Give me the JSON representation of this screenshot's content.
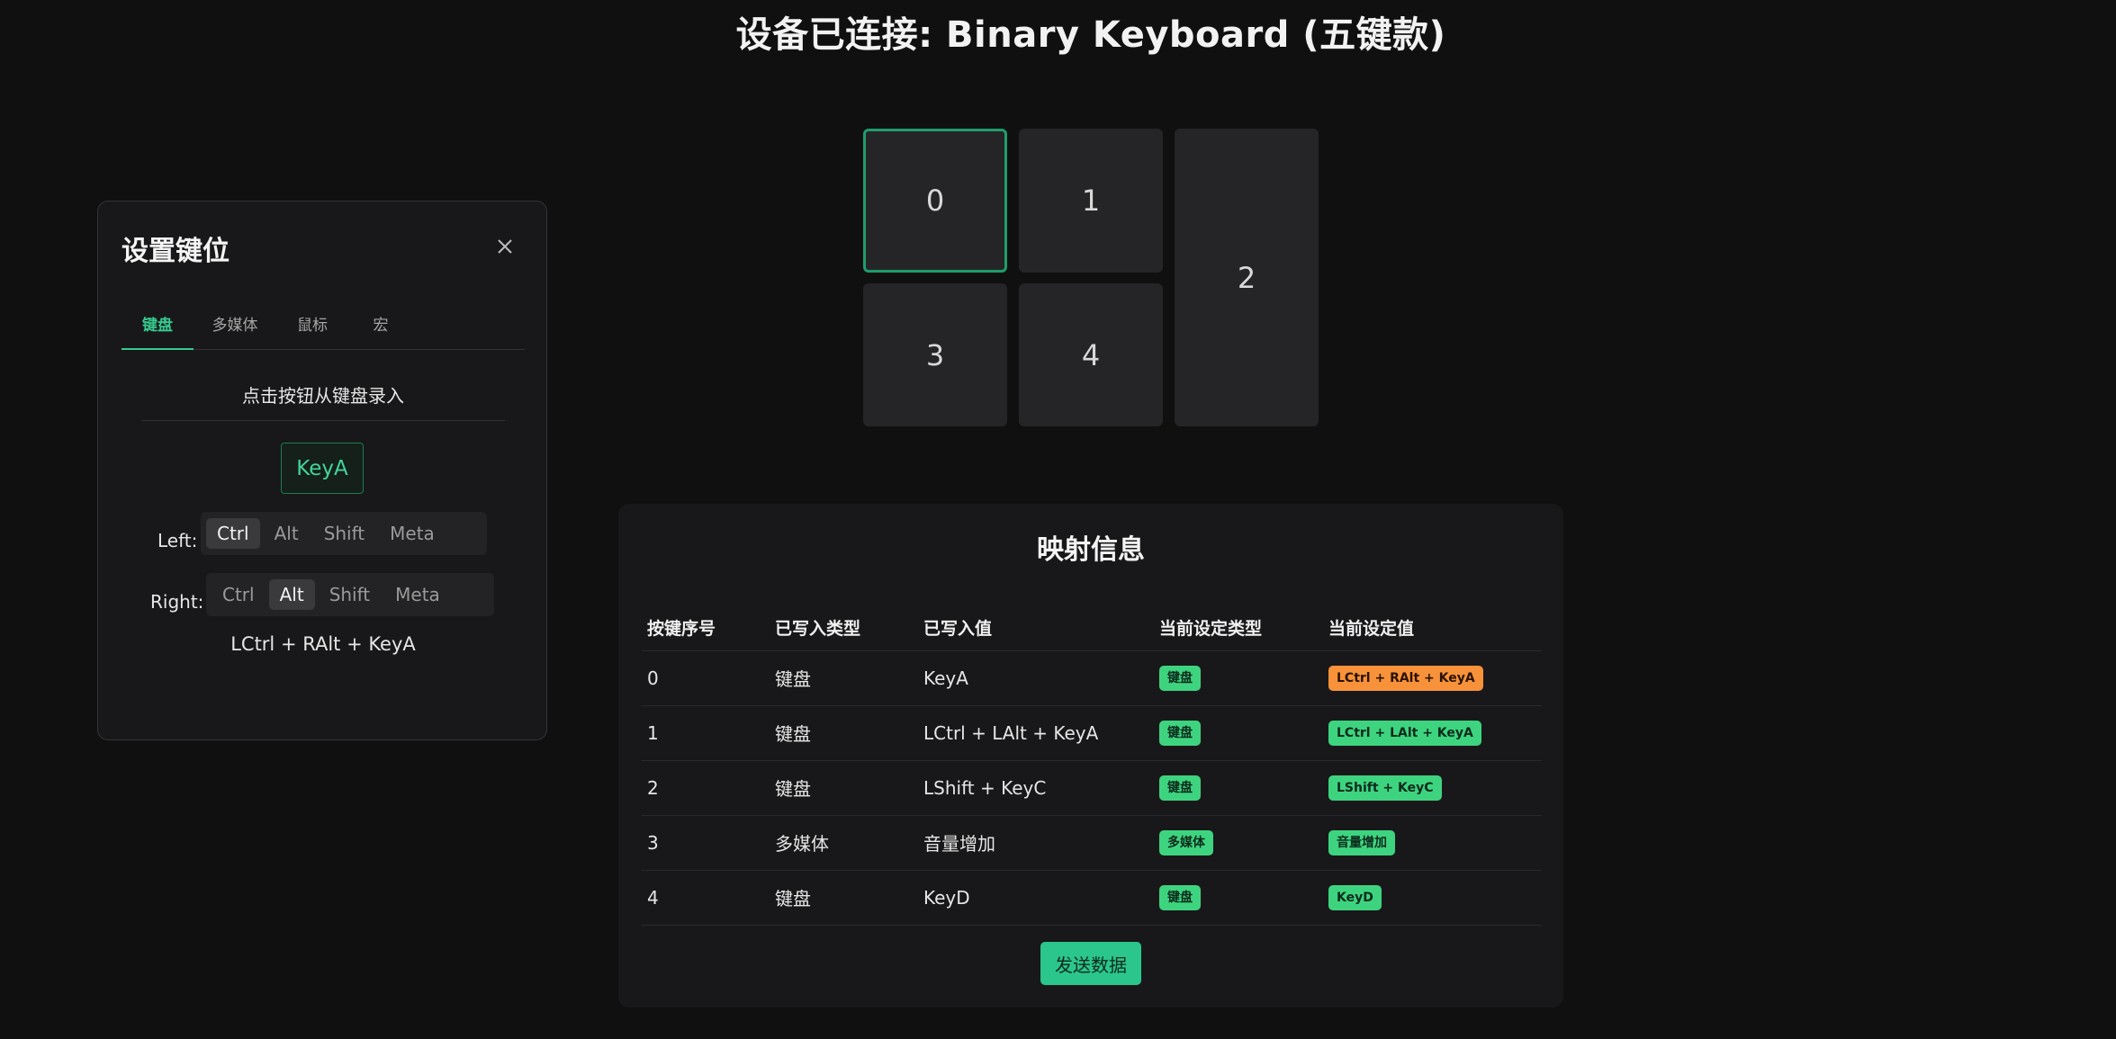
{
  "title": "设备已连接: Binary Keyboard (五键款)",
  "keys": [
    {
      "label": "0"
    },
    {
      "label": "1"
    },
    {
      "label": "2"
    },
    {
      "label": "3"
    },
    {
      "label": "4"
    }
  ],
  "dialog": {
    "title": "设置键位",
    "close_icon": "close-icon",
    "tabs": [
      {
        "label": "键盘"
      },
      {
        "label": "多媒体"
      },
      {
        "label": "鼠标"
      },
      {
        "label": "宏"
      }
    ],
    "active_tab": "键盘",
    "record_hint": "点击按钮从键盘录入",
    "recorded_key": "KeyA",
    "left_label": "Left:",
    "right_label": "Right:",
    "modifiers": [
      "Ctrl",
      "Alt",
      "Shift",
      "Meta"
    ],
    "left_selected": "Ctrl",
    "right_selected": "Alt",
    "combo": "LCtrl + RAlt + KeyA"
  },
  "mapping": {
    "title": "映射信息",
    "headers": [
      "按键序号",
      "已写入类型",
      "已写入值",
      "当前设定类型",
      "当前设定值"
    ],
    "rows": [
      {
        "index": "0",
        "written_type": "键盘",
        "written_value": "KeyA",
        "current_type": "键盘",
        "current_value": "LCtrl + RAlt + KeyA",
        "current_value_color": "#f7923a"
      },
      {
        "index": "1",
        "written_type": "键盘",
        "written_value": "LCtrl + LAlt + KeyA",
        "current_type": "键盘",
        "current_value": "LCtrl + LAlt + KeyA",
        "current_value_color": "#3ed47f"
      },
      {
        "index": "2",
        "written_type": "键盘",
        "written_value": "LShift + KeyC",
        "current_type": "键盘",
        "current_value": "LShift + KeyC",
        "current_value_color": "#3ed47f"
      },
      {
        "index": "3",
        "written_type": "多媒体",
        "written_value": "音量增加",
        "current_type": "多媒体",
        "current_value": "音量增加",
        "current_value_color": "#3ed47f"
      },
      {
        "index": "4",
        "written_type": "键盘",
        "written_value": "KeyD",
        "current_type": "键盘",
        "current_value": "KeyD",
        "current_value_color": "#3ed47f"
      }
    ],
    "send_label": "发送数据"
  },
  "colors": {
    "accent": "#36c98f",
    "tag_green": "#3ed47f",
    "tag_orange": "#f7923a",
    "background": "#101010",
    "panel": "#18181a"
  }
}
